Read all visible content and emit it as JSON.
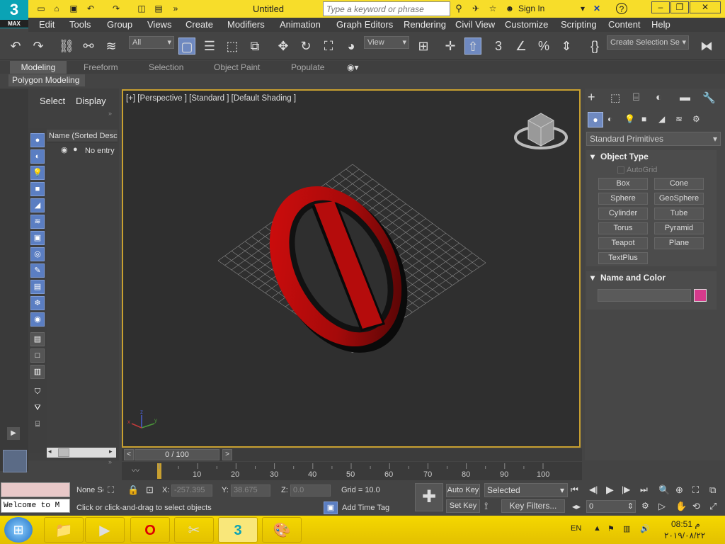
{
  "app": {
    "logo_text": "3",
    "logo_sub": "MAX",
    "title": "Untitled"
  },
  "search": {
    "placeholder": "Type a keyword or phrase"
  },
  "sign_in": "Sign In",
  "menus": [
    "Edit",
    "Tools",
    "Group",
    "Views",
    "Create",
    "Modifiers",
    "Animation",
    "Graph Editors",
    "Rendering",
    "Civil View",
    "Customize",
    "Scripting",
    "Content",
    "Help"
  ],
  "toolbar": {
    "filter_all": "All",
    "ref_coord": "View",
    "selection_set": "Create Selection Se"
  },
  "ribbon": {
    "tabs": [
      "Modeling",
      "Freeform",
      "Selection",
      "Object Paint",
      "Populate"
    ],
    "sub": "Polygon Modeling"
  },
  "scene_explorer": {
    "tabs": [
      "Select",
      "Display"
    ],
    "column_header": "Name (Sorted Desce",
    "entry": "No entry"
  },
  "viewport": {
    "label": "[+] [Perspective ] [Standard ] [Default Shading ]"
  },
  "command_panel": {
    "category": "Standard Primitives",
    "rollout_object_type": "Object Type",
    "autogrid": "AutoGrid",
    "buttons": [
      "Box",
      "Cone",
      "Sphere",
      "GeoSphere",
      "Cylinder",
      "Tube",
      "Torus",
      "Pyramid",
      "Teapot",
      "Plane",
      "TextPlus"
    ],
    "rollout_name_color": "Name and Color",
    "swatch_color": "#d63a8c"
  },
  "timeline": {
    "frame": "0 / 100",
    "ticks": [
      "10",
      "20",
      "30",
      "40",
      "50",
      "60",
      "70",
      "80",
      "90",
      "100"
    ]
  },
  "status": {
    "listener": "Welcome to M",
    "selected": "None Se",
    "x_label": "X:",
    "x_value": "-257.395",
    "y_label": "Y:",
    "y_value": "38.675",
    "z_label": "Z:",
    "z_value": "0.0",
    "grid": "Grid = 10.0",
    "prompt": "Click or click-and-drag to select objects",
    "add_time_tag": "Add Time Tag",
    "auto_key": "Auto Key",
    "set_key": "Set Key",
    "key_mode": "Selected",
    "key_filters": "Key Filters...",
    "frame_field": "0"
  },
  "taskbar": {
    "lang": "EN",
    "time": "08:51 م",
    "date": "٢٠١٩/٠٨/٢٢"
  }
}
